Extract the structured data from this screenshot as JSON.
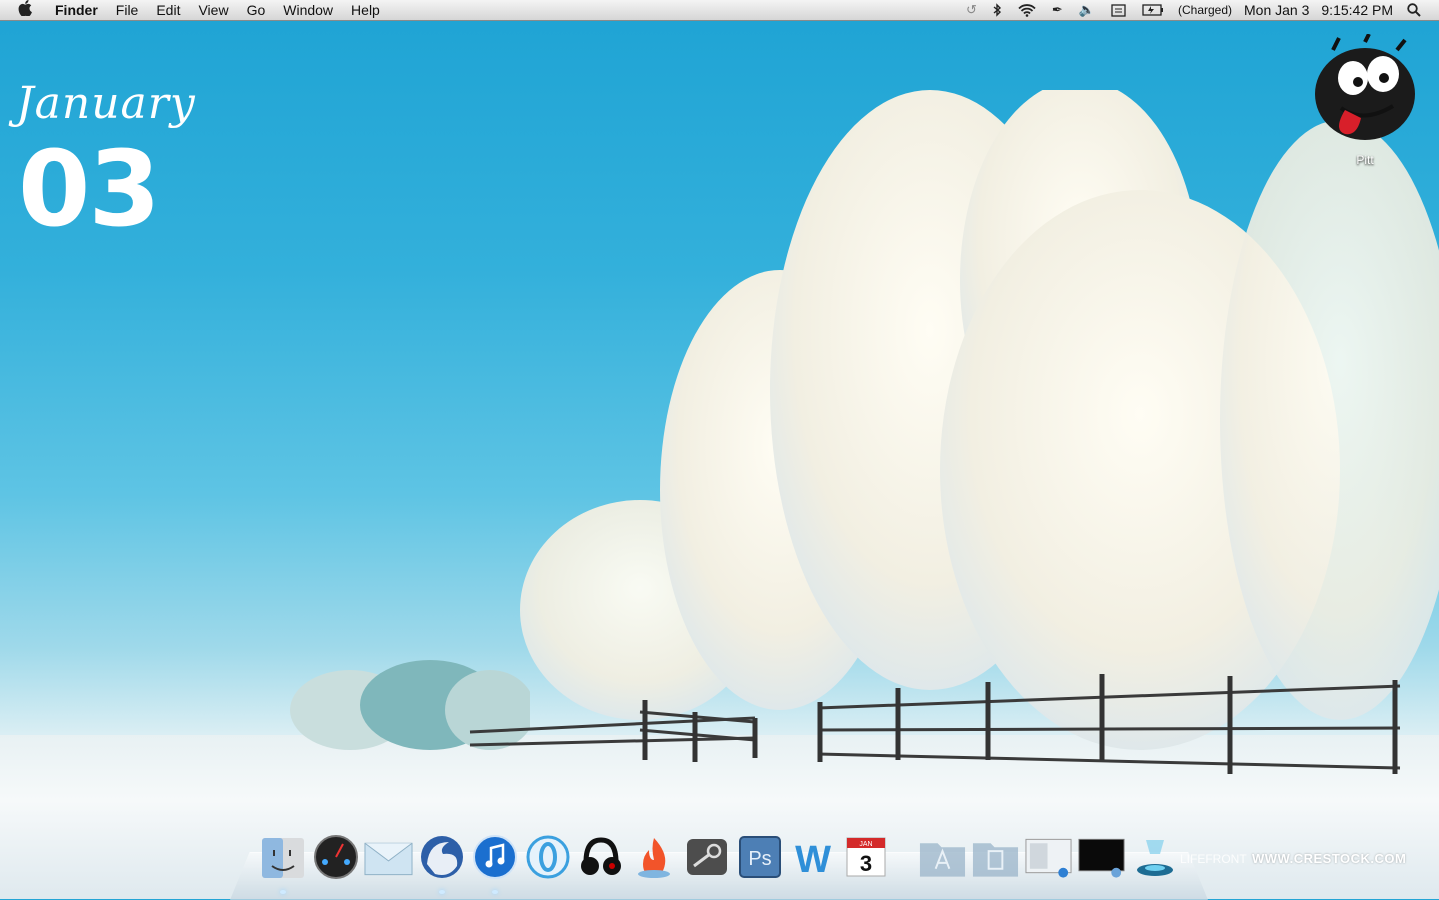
{
  "menubar": {
    "apple_icon": "apple-icon",
    "app_name": "Finder",
    "menus": [
      "File",
      "Edit",
      "View",
      "Go",
      "Window",
      "Help"
    ],
    "status": {
      "battery_text": "(Charged)",
      "date": "Mon Jan 3",
      "time": "9:15:42 PM"
    }
  },
  "widget": {
    "month": "January",
    "day": "03"
  },
  "desktop": {
    "icon_label": "Pitt"
  },
  "dock": {
    "items": [
      "finder-icon",
      "dashboard-icon",
      "mail-icon",
      "firefox-icon",
      "itunes-icon",
      "opera-icon",
      "headphones-icon",
      "burn-icon",
      "steam-icon",
      "photoshop-icon",
      "word-icon",
      "ical-icon",
      "applications-folder-icon",
      "documents-folder-icon",
      "preview-icon",
      "terminal-icon",
      "frontrow-icon"
    ],
    "calendar_month": "JAN",
    "calendar_day": "3",
    "photoshop_label": "Ps",
    "word_label": "W"
  },
  "watermark": {
    "prefix": "LIFEFRONT",
    "site": "WWW.CRESTOCK.COM"
  }
}
